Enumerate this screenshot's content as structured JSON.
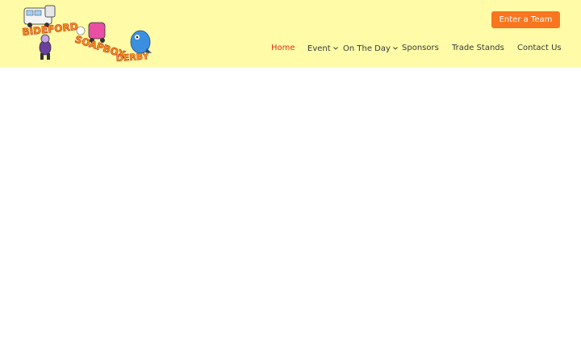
{
  "header": {
    "logo": {
      "text_line1": "BIDEFORD",
      "text_line2": "SOAPBOX",
      "text_line3": "DERBY"
    },
    "cta_label": "Enter a Team",
    "nav": [
      {
        "label": "Home",
        "active": true,
        "has_dropdown": false
      },
      {
        "label": "Event",
        "active": false,
        "has_dropdown": true
      },
      {
        "label": "On The Day",
        "active": false,
        "has_dropdown": true
      },
      {
        "label": "Sponsors",
        "active": false,
        "has_dropdown": false
      },
      {
        "label": "Trade Stands",
        "active": false,
        "has_dropdown": false
      },
      {
        "label": "Contact Us",
        "active": false,
        "has_dropdown": false
      }
    ]
  },
  "colors": {
    "header_bg": "#fffba6",
    "cta_bg": "#f7761f",
    "nav_active": "#e0301e",
    "nav_text": "#3a3a3a"
  }
}
